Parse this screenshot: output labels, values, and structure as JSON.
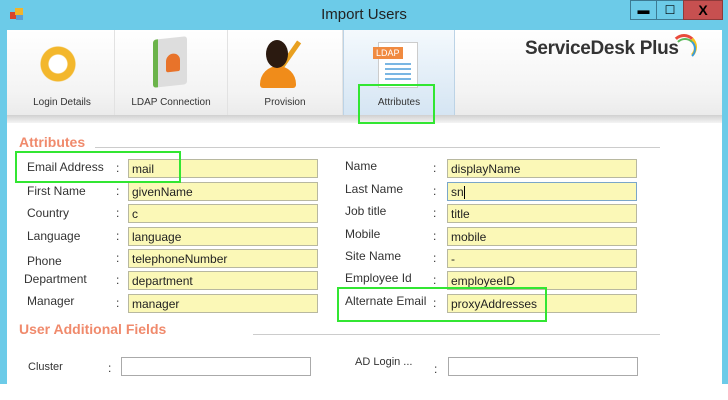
{
  "window": {
    "title": "Import Users",
    "minimize": "▬",
    "maximize": "☐",
    "close": "X"
  },
  "toolbar": {
    "tabs": [
      {
        "label": "Login Details"
      },
      {
        "label": "LDAP Connection"
      },
      {
        "label": "Provision"
      },
      {
        "label": "Attributes",
        "badge": "LDAP"
      }
    ],
    "logo": "ServiceDesk Plus"
  },
  "attributes": {
    "heading": "Attributes",
    "colon": ":",
    "left": [
      {
        "label": "Email Address",
        "value": "mail"
      },
      {
        "label": "First Name",
        "value": "givenName"
      },
      {
        "label": "Country",
        "value": "c"
      },
      {
        "label": "Language",
        "value": "language"
      },
      {
        "label": "Phone",
        "value": "telephoneNumber"
      },
      {
        "label": "Department",
        "value": "department"
      },
      {
        "label": "Manager",
        "value": "manager"
      }
    ],
    "right": [
      {
        "label": "Name",
        "value": "displayName"
      },
      {
        "label": "Last Name",
        "value": "sn"
      },
      {
        "label": "Job title",
        "value": "title"
      },
      {
        "label": "Mobile",
        "value": "mobile"
      },
      {
        "label": "Site Name",
        "value": "-"
      },
      {
        "label": "Employee Id",
        "value": "employeeID"
      },
      {
        "label": "Alternate Email",
        "value": "proxyAddresses"
      }
    ]
  },
  "additional": {
    "heading": "User Additional Fields",
    "fields": [
      {
        "label": "Cluster",
        "value": ""
      },
      {
        "label": "AD Login ...",
        "value": ""
      }
    ]
  }
}
